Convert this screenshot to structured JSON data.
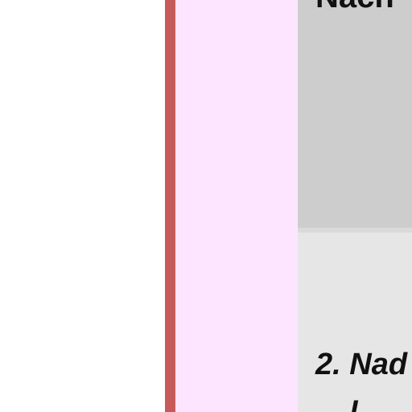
{
  "document": {
    "top_cell_text": "Nach",
    "bottom_cell_text": "2. Nad",
    "bottom_cell_text_next_line": "l"
  },
  "colors": {
    "background": "#ffffff",
    "accent_bar": "#c65a5a",
    "pink_column": "#fde5ff",
    "top_cell": "#cdcdcd",
    "bottom_cell": "#e6e6e6"
  }
}
